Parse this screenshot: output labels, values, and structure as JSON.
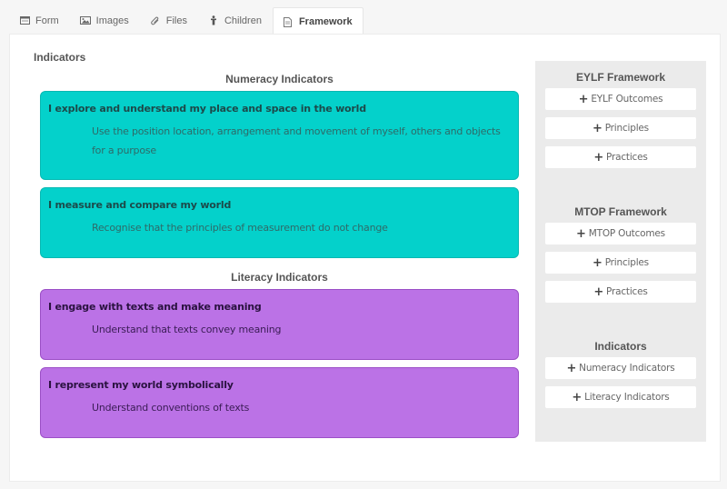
{
  "tabs": [
    {
      "label": "Form",
      "icon": "form-icon",
      "active": false
    },
    {
      "label": "Images",
      "icon": "image-icon",
      "active": false
    },
    {
      "label": "Files",
      "icon": "paperclip-icon",
      "active": false
    },
    {
      "label": "Children",
      "icon": "child-icon",
      "active": false
    },
    {
      "label": "Framework",
      "icon": "document-icon",
      "active": true
    }
  ],
  "main": {
    "section_title": "Indicators",
    "groups": [
      {
        "title": "Numeracy Indicators",
        "color": "#04d1cb",
        "cards": [
          {
            "title": "I explore and understand my place and space in the world",
            "description": "Use the position location, arrangement and movement of myself, others and objects for a purpose"
          },
          {
            "title": "I measure and compare my world",
            "description": "Recognise that the principles of measurement do not change"
          }
        ]
      },
      {
        "title": "Literacy Indicators",
        "color": "#bb72e6",
        "cards": [
          {
            "title": "I engage with texts and make meaning",
            "description": "Understand that texts convey meaning"
          },
          {
            "title": "I represent my world symbolically",
            "description": "Understand conventions of texts"
          }
        ]
      }
    ]
  },
  "sidebar": {
    "sections": [
      {
        "title": "EYLF Framework",
        "buttons": [
          "EYLF Outcomes",
          "Principles",
          "Practices"
        ]
      },
      {
        "title": "MTOP Framework",
        "buttons": [
          "MTOP Outcomes",
          "Principles",
          "Practices"
        ]
      },
      {
        "title": "Indicators",
        "buttons": [
          "Numeracy Indicators",
          "Literacy Indicators"
        ]
      }
    ],
    "button_icon": "plus-icon"
  }
}
